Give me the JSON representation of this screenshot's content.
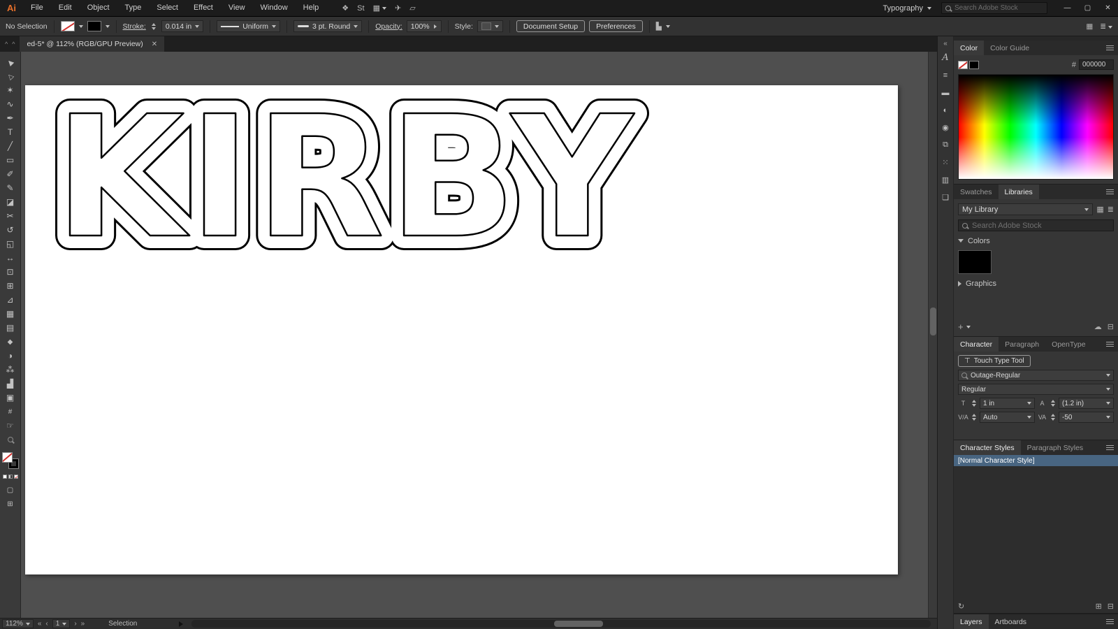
{
  "menubar": {
    "logo": "Ai",
    "menus": [
      "File",
      "Edit",
      "Object",
      "Type",
      "Select",
      "Effect",
      "View",
      "Window",
      "Help"
    ],
    "workspace_label": "Typography",
    "search_placeholder": "Search Adobe Stock",
    "window_icons": {
      "minimize": "—",
      "maximize": "▢",
      "close": "✕"
    },
    "app_icons": [
      {
        "name": "bridge-icon",
        "glyph": "❖"
      },
      {
        "name": "stock-icon",
        "glyph": "St"
      },
      {
        "name": "arrange-documents-icon",
        "glyph": "▦"
      },
      {
        "name": "share-icon",
        "glyph": "✈"
      },
      {
        "name": "device-preview-icon",
        "glyph": "▱"
      }
    ]
  },
  "controlbar": {
    "selection_status": "No Selection",
    "stroke_label": "Stroke:",
    "stroke_weight": "0.014 in",
    "profile_label": "Uniform",
    "brush_label": "3 pt. Round",
    "opacity_label": "Opacity:",
    "opacity_value": "100%",
    "style_label": "Style:",
    "document_setup_label": "Document Setup",
    "preferences_label": "Preferences",
    "align_glyph": "▙",
    "arrange_glyph": "▦",
    "panel_menu_glyph": "≣"
  },
  "tabbar": {
    "left_icon": "^",
    "right_icon": "^",
    "title": "ed-5* @ 112% (RGB/GPU Preview)",
    "close_glyph": "✕"
  },
  "toolbar": {
    "tools": [
      {
        "name": "selection-tool",
        "glyph": "▶"
      },
      {
        "name": "direct-selection-tool",
        "glyph": "▷"
      },
      {
        "name": "magic-wand-tool",
        "glyph": "✶"
      },
      {
        "name": "lasso-tool",
        "glyph": "∿"
      },
      {
        "name": "pen-tool",
        "glyph": "✒"
      },
      {
        "name": "type-tool",
        "glyph": "T"
      },
      {
        "name": "line-segment-tool",
        "glyph": "╱"
      },
      {
        "name": "rectangle-tool",
        "glyph": "▭"
      },
      {
        "name": "paintbrush-tool",
        "glyph": "✐"
      },
      {
        "name": "pencil-tool",
        "glyph": "✎"
      },
      {
        "name": "eraser-tool",
        "glyph": "◪"
      },
      {
        "name": "scissors-tool",
        "glyph": "✂"
      },
      {
        "name": "rotate-tool",
        "glyph": "↺"
      },
      {
        "name": "scale-tool",
        "glyph": "◱"
      },
      {
        "name": "width-tool",
        "glyph": "↔"
      },
      {
        "name": "free-transform-tool",
        "glyph": "⊡"
      },
      {
        "name": "shape-builder-tool",
        "glyph": "⊞"
      },
      {
        "name": "perspective-grid-tool",
        "glyph": "⊿"
      },
      {
        "name": "mesh-tool",
        "glyph": "▦"
      },
      {
        "name": "gradient-tool",
        "glyph": "▤"
      },
      {
        "name": "eyedropper-tool",
        "glyph": "◆"
      },
      {
        "name": "blend-tool",
        "glyph": "◑"
      },
      {
        "name": "symbol-sprayer-tool",
        "glyph": "⁂"
      },
      {
        "name": "column-graph-tool",
        "glyph": "▟"
      },
      {
        "name": "artboard-tool",
        "glyph": "▣"
      },
      {
        "name": "slice-tool",
        "glyph": "#"
      },
      {
        "name": "hand-tool",
        "glyph": "☞"
      }
    ]
  },
  "artboard": {
    "word": "KIRBY"
  },
  "right_strip": {
    "collapse_glyph": "«",
    "icons": [
      {
        "name": "character-panel-icon",
        "glyph": "A"
      },
      {
        "name": "paragraph-panel-icon",
        "glyph": "≡"
      },
      {
        "name": "stroke-panel-icon",
        "glyph": "▬"
      },
      {
        "name": "gradient-panel-icon",
        "glyph": "◐"
      },
      {
        "name": "color-panel-icon",
        "glyph": "◉"
      },
      {
        "name": "transform-panel-icon",
        "glyph": "⧉"
      },
      {
        "name": "appearance-panel-icon",
        "glyph": "⁙"
      },
      {
        "name": "graphic-styles-panel-icon",
        "glyph": "▥"
      },
      {
        "name": "layers-panel-icon",
        "glyph": "❏"
      }
    ]
  },
  "panels": {
    "color": {
      "tab_color": "Color",
      "tab_color_guide": "Color Guide",
      "hex_prefix": "#",
      "hex_value": "000000"
    },
    "libraries": {
      "tab_swatches": "Swatches",
      "tab_libraries": "Libraries",
      "library_name": "My Library",
      "search_placeholder": "Search Adobe Stock",
      "colors_section": "Colors",
      "graphics_section": "Graphics",
      "icons": {
        "grid": "▦",
        "list": "≣",
        "add": "+",
        "cloud": "☁",
        "trash": "⊟"
      }
    },
    "character": {
      "tab_character": "Character",
      "tab_paragraph": "Paragraph",
      "tab_opentype": "OpenType",
      "touch_type_label": "Touch Type Tool",
      "font_name": "Outage-Regular",
      "font_style": "Regular",
      "size_value": "1 in",
      "leading_value": "(1.2 in)",
      "kerning_value": "Auto",
      "tracking_value": "-50",
      "icons": {
        "touch": "⊤",
        "size": "T",
        "leading": "A",
        "kerning": "V/A",
        "tracking": "VA"
      }
    },
    "styles": {
      "tab_character_styles": "Character Styles",
      "tab_paragraph_styles": "Paragraph Styles",
      "selected_style": "[Normal Character Style]",
      "icons": {
        "sync": "↻",
        "new": "⊞",
        "delete": "⊟"
      }
    },
    "bottom_tabs": {
      "layers": "Layers",
      "artboards": "Artboards"
    }
  },
  "statusbar": {
    "zoom_value": "112%",
    "artboard_number": "1",
    "status_text": "Selection",
    "icons": {
      "first": "«",
      "prev": "‹",
      "next": "›",
      "last": "»"
    }
  }
}
